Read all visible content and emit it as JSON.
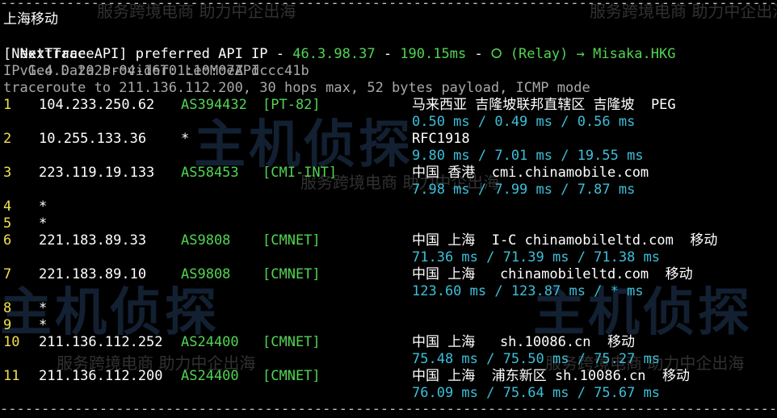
{
  "watermark": {
    "small_text": "服务跨境电商 助力中企出海",
    "big_text": "主机侦探"
  },
  "header": {
    "separator": "------------------------------------------------------------------------------------------------------------------",
    "location_label": "上海移动",
    "app_name": "NextTrace",
    "version": "v1.4.0 2025-04-16T01:10:07Z dccc41b",
    "api_prefix": "[NextTrace API] preferred API IP - ",
    "api_ip": "46.3.98.37",
    "api_dash1": " - ",
    "api_latency": "190.15ms",
    "api_dash2": " - ",
    "api_relay": "⭘ (Relay) → Misaka.HKG",
    "geo_provider": "IP Geo Data Provider: LeoMoeAPI",
    "traceroute_line": "traceroute to 211.136.112.200, 30 hops max, 52 bytes payload, ICMP mode"
  },
  "hops": [
    {
      "num": "1",
      "ip": "104.233.250.62",
      "asn": "AS394432",
      "tag": "[PT-82]",
      "geo": "马来西亚 吉隆坡联邦直辖区 吉隆坡  PEG",
      "rtt": "0.50 ms / 0.49 ms / 0.56 ms"
    },
    {
      "num": "2",
      "ip": "10.255.133.36",
      "asn": "*",
      "tag": "",
      "geo": "RFC1918",
      "rtt": "9.80 ms / 7.01 ms / 19.55 ms"
    },
    {
      "num": "3",
      "ip": "223.119.19.133",
      "asn": "AS58453",
      "tag": "[CMI-INT]",
      "geo": "中国 香港  cmi.chinamobile.com",
      "rtt": "7.98 ms / 7.99 ms / 7.87 ms"
    },
    {
      "num": "4",
      "ip": "*",
      "asn": "",
      "tag": "",
      "geo": "",
      "rtt": ""
    },
    {
      "num": "5",
      "ip": "*",
      "asn": "",
      "tag": "",
      "geo": "",
      "rtt": ""
    },
    {
      "num": "6",
      "ip": "221.183.89.33",
      "asn": "AS9808",
      "tag": "[CMNET]",
      "geo": "中国 上海  I-C chinamobileltd.com  移动",
      "rtt": "71.36 ms / 71.39 ms / 71.38 ms"
    },
    {
      "num": "7",
      "ip": "221.183.89.10",
      "asn": "AS9808",
      "tag": "[CMNET]",
      "geo": "中国 上海   chinamobileltd.com  移动",
      "rtt": "123.60 ms / 123.87 ms / * ms"
    },
    {
      "num": "8",
      "ip": "*",
      "asn": "",
      "tag": "",
      "geo": "",
      "rtt": ""
    },
    {
      "num": "9",
      "ip": "*",
      "asn": "",
      "tag": "",
      "geo": "",
      "rtt": ""
    },
    {
      "num": "10",
      "ip": "211.136.112.252",
      "asn": "AS24400",
      "tag": "[CMNET]",
      "geo": "中国 上海   sh.10086.cn  移动",
      "rtt": "75.48 ms / 75.50 ms / 75.27 ms"
    },
    {
      "num": "11",
      "ip": "211.136.112.200",
      "asn": "AS24400",
      "tag": "[CMNET]",
      "geo": "中国 上海  浦东新区 sh.10086.cn  移动",
      "rtt": "76.09 ms / 75.64 ms / 75.67 ms"
    }
  ],
  "colors": {
    "background": "#000000",
    "text": "#ffffff",
    "hop_number": "#f0e050",
    "asn": "#52d452",
    "rtt": "#3cbfd8"
  }
}
